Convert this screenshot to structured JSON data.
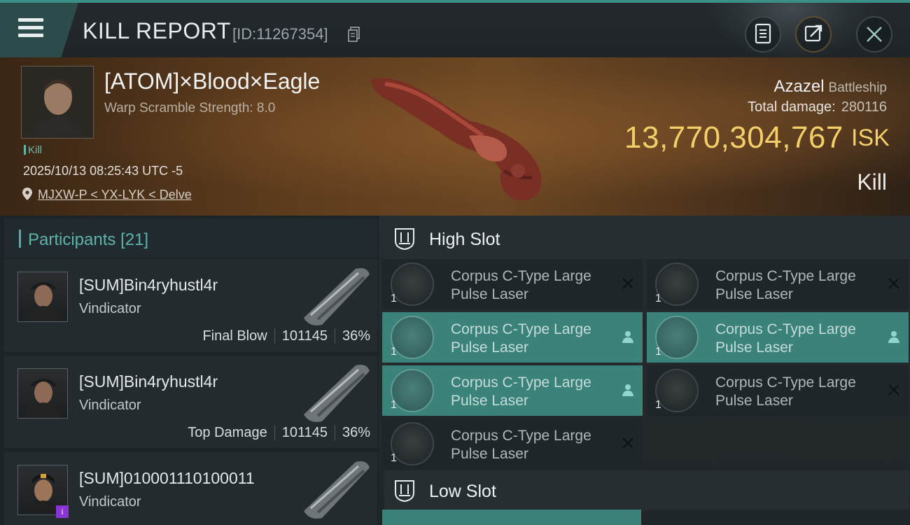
{
  "header": {
    "title": "KILL REPORT",
    "report_id": "[ID:11267354]"
  },
  "victim": {
    "name": "[ATOM]×Blood×Eagle",
    "scramble": "Warp Scramble Strength: 8.0",
    "tag": "Kill",
    "time": "2025/10/13 08:25:43 UTC -5",
    "location": "MJXW-P < YX-LYK < Delve",
    "ship_name": "Azazel",
    "ship_class": "Battleship",
    "damage_label": "Total damage:",
    "damage_value": "280116",
    "isk_value": "13,770,304,767",
    "isk_unit": "ISK",
    "result": "Kill"
  },
  "participants": {
    "title": "Participants",
    "count": "[21]",
    "rows": [
      {
        "name": "[SUM]Bin4ryhustl4r",
        "ship": "Vindicator",
        "label": "Final Blow",
        "damage": "101145",
        "percent": "36%"
      },
      {
        "name": "[SUM]Bin4ryhustl4r",
        "ship": "Vindicator",
        "label": "Top Damage",
        "damage": "101145",
        "percent": "36%"
      },
      {
        "name": "[SUM]010001110100011",
        "ship": "Vindicator",
        "badge": "i"
      }
    ]
  },
  "slots": {
    "high": {
      "title": "High Slot",
      "modules": [
        {
          "name": "Corpus C-Type Large Pulse Laser",
          "qty": "1",
          "state": "destroyed"
        },
        {
          "name": "Corpus C-Type Large Pulse Laser",
          "qty": "1",
          "state": "destroyed"
        },
        {
          "name": "Corpus C-Type Large Pulse Laser",
          "qty": "1",
          "state": "dropped"
        },
        {
          "name": "Corpus C-Type Large Pulse Laser",
          "qty": "1",
          "state": "dropped"
        },
        {
          "name": "Corpus C-Type Large Pulse Laser",
          "qty": "1",
          "state": "dropped"
        },
        {
          "name": "Corpus C-Type Large Pulse Laser",
          "qty": "1",
          "state": "destroyed"
        },
        {
          "name": "Corpus C-Type Large Pulse Laser",
          "qty": "1",
          "state": "destroyed"
        }
      ]
    },
    "low": {
      "title": "Low Slot"
    }
  },
  "colors": {
    "accent": "#3a8f86",
    "isk": "#f3cf69",
    "highlight_row": "#3a827a",
    "purple_badge": "#8b34d6"
  }
}
